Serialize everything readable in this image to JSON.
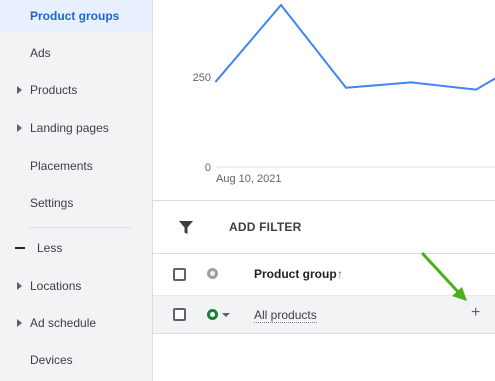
{
  "sidebar": {
    "items": [
      {
        "label": "Product groups",
        "active": true,
        "expandable": false
      },
      {
        "label": "Ads",
        "active": false,
        "expandable": false
      },
      {
        "label": "Products",
        "active": false,
        "expandable": true
      },
      {
        "label": "Landing pages",
        "active": false,
        "expandable": true
      },
      {
        "label": "Placements",
        "active": false,
        "expandable": false
      },
      {
        "label": "Settings",
        "active": false,
        "expandable": false
      }
    ],
    "less_label": "Less",
    "more_items": [
      {
        "label": "Locations",
        "expandable": true
      },
      {
        "label": "Ad schedule",
        "expandable": true
      },
      {
        "label": "Devices",
        "expandable": false
      }
    ]
  },
  "chart_data": {
    "type": "line",
    "x": [
      "Aug 10, 2021",
      "",
      "",
      "",
      "",
      ""
    ],
    "series": [
      {
        "values": [
          238,
          450,
          220,
          235,
          215,
          320
        ]
      }
    ],
    "xtick_labels": [
      "Aug 10, 2021"
    ],
    "ytick_labels": [
      "0",
      "250"
    ],
    "ylim": [
      0,
      500
    ],
    "color": "#4285f4",
    "grid": false
  },
  "filter": {
    "label": "ADD FILTER",
    "icon": "filter-icon"
  },
  "table": {
    "header": {
      "column": "Product group",
      "sort_icon": "↑"
    },
    "rows": [
      {
        "product_group": "All products",
        "status": "enabled",
        "status_color": "#188038",
        "action_icon": "+"
      }
    ]
  },
  "annotation": {
    "arrow_color": "#4caf1a"
  }
}
